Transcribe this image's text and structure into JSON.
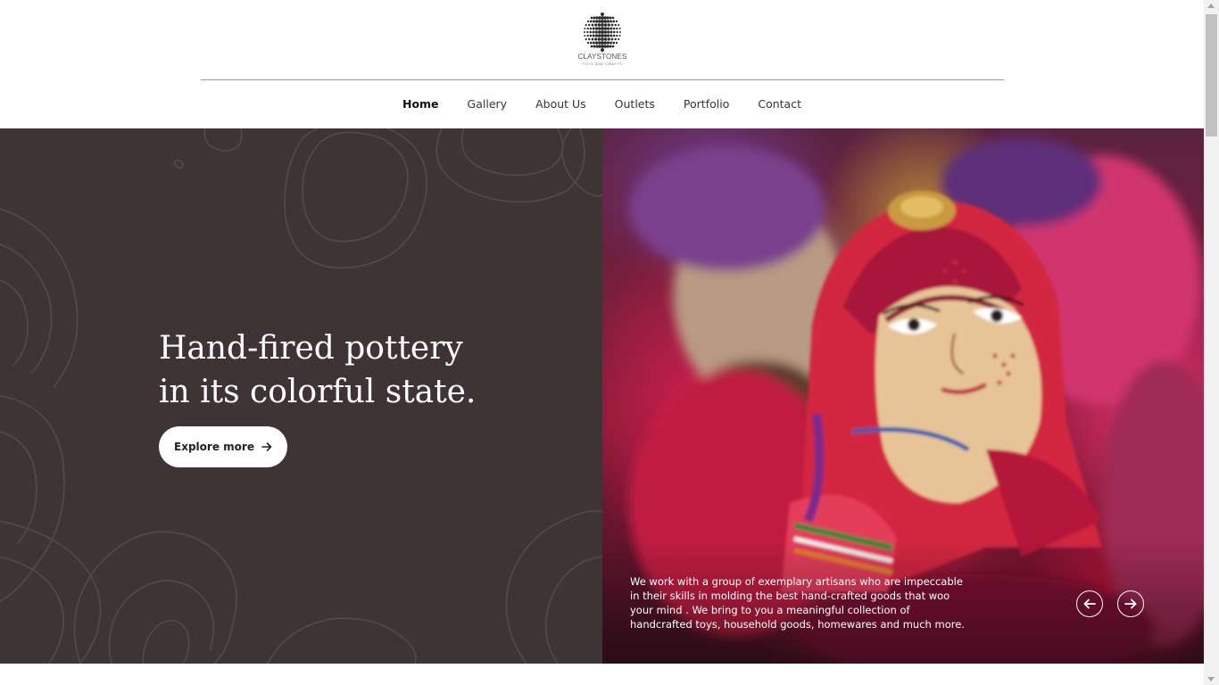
{
  "brand": {
    "name": "CLAYSTONES",
    "tagline": "TOYS AND CRAFTS"
  },
  "nav": {
    "items": [
      "Home",
      "Gallery",
      "About Us",
      "Outlets",
      "Portfolio",
      "Contact"
    ],
    "active": "Home"
  },
  "hero": {
    "headline_line1": "Hand-fired pottery",
    "headline_line2": "in its colorful state.",
    "cta_label": "Explore more",
    "caption_lines": [
      "We work with a group of exemplary artisans who are impeccable",
      "in their skills in molding the best hand-crafted goods that woo",
      "your mind . We bring to you a meaningful collection of",
      "handcrafted toys, household goods, homewares and much more."
    ]
  },
  "icons": {
    "logo": "dotted-sphere-logo",
    "cta": "arrow-right-icon",
    "prev": "arrow-left-icon",
    "next": "arrow-right-icon"
  },
  "colors": {
    "hero_left_bg": "#3f3435",
    "text_on_dark": "#ffffff",
    "nav_text": "#333333",
    "rule": "#9a9a9a"
  }
}
